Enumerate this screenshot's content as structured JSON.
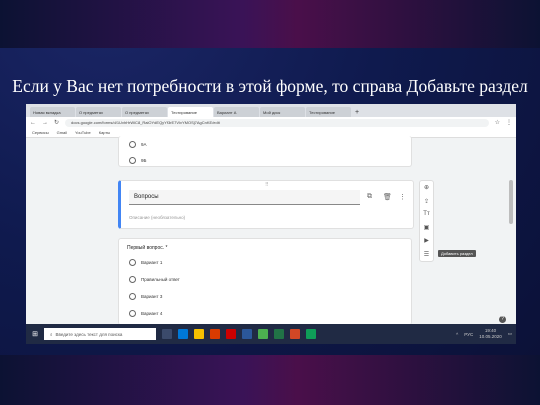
{
  "slide": {
    "caption": "Если у Вас нет потребности в этой форме, то справа Добавьте раздел"
  },
  "browser": {
    "tabs": [
      "Новая вкладка",
      "О предметах",
      "О предметах",
      "Тестирование",
      "Вариант А",
      "Мой диск",
      "Тестирование"
    ],
    "new_tab_icon": "+",
    "url": "docs.google.com/forms/d/1UvhHrWiC8_RaiOYdEQyYf3rE7VlvYMOSj7AgCnKE/edit",
    "bookmarks": [
      "Сервисы",
      "Gmail",
      "YouTube",
      "Карты"
    ]
  },
  "form": {
    "options_top": [
      "9A",
      "9Б"
    ],
    "section": {
      "title": "Вопросы",
      "description": "Описание (необязательно)"
    },
    "question": {
      "title": "Первый вопрос. *",
      "options": [
        "Вариант 1",
        "Правильный ответ",
        "Вариант 3",
        "Вариант 4"
      ]
    },
    "sidebar_tooltip": "Добавить раздел"
  },
  "taskbar": {
    "search_placeholder": "Введите здесь текст для поиска",
    "lang": "РУС",
    "time": "19:40",
    "date": "10.05.2020"
  }
}
